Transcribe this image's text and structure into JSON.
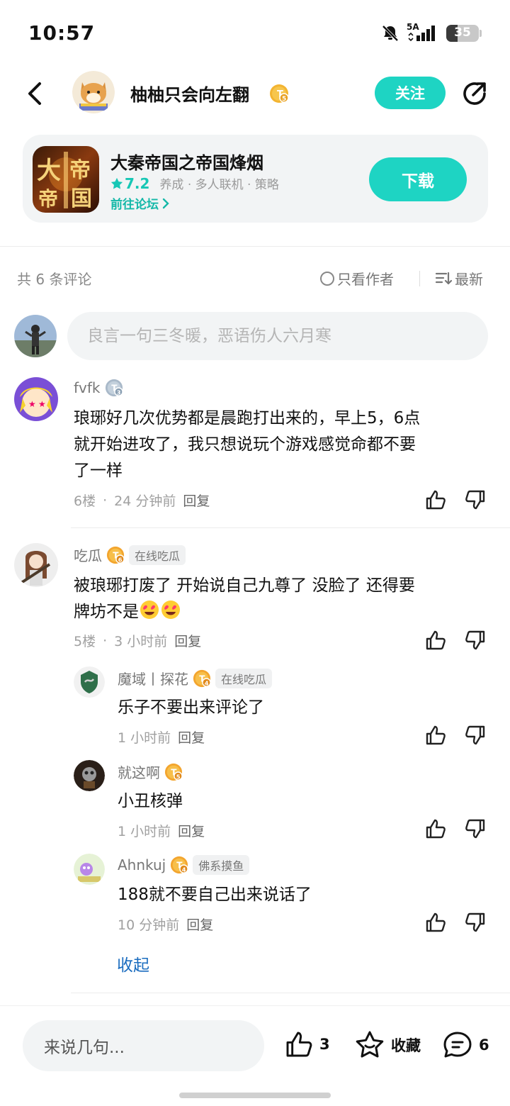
{
  "status": {
    "time": "10:57",
    "network": "5A",
    "battery": "35",
    "battery_level": 0.35
  },
  "header": {
    "username": "柚柚只会向左翻",
    "level": "5",
    "follow_label": "关注"
  },
  "game": {
    "title": "大秦帝国之帝国烽烟",
    "rating": "7.2",
    "tags": "养成 · 多人联机 · 策略",
    "forum_label": "前往论坛",
    "download_label": "下载",
    "icon_text_a": "大",
    "icon_text_b": "帝",
    "icon_text_c": "帝",
    "icon_text_d": "国"
  },
  "comments_bar": {
    "count_label": "共 6 条评论",
    "author_only_label": "只看作者",
    "sort_label": "最新"
  },
  "input": {
    "placeholder": "良言一句三冬暖，恶语伤人六月寒"
  },
  "comments": [
    {
      "name": "fvfk",
      "level": "3",
      "tag": "",
      "text_lines": [
        "琅琊好几次优势都是晨跑打出来的，早上5，6点",
        "就开始进攻了，我只想说玩个游戏感觉命都不要",
        "了一样"
      ],
      "floor": "6楼",
      "time": "24 分钟前",
      "reply_label": "回复"
    },
    {
      "name": "吃瓜",
      "level": "6",
      "tag": "在线吃瓜",
      "text_lines": [
        "被琅琊打废了  开始说自己九尊了   没脸了  还得要",
        "牌坊不是"
      ],
      "floor": "5楼",
      "time": "3 小时前",
      "reply_label": "回复"
    }
  ],
  "replies": [
    {
      "name": "魔域丨探花",
      "level": "4",
      "tag": "在线吃瓜",
      "text": "乐子不要出来评论了",
      "time": "1 小时前",
      "reply_label": "回复"
    },
    {
      "name": "就这啊",
      "level": "5",
      "tag": "",
      "text": "小丑核弹",
      "time": "1 小时前",
      "reply_label": "回复"
    },
    {
      "name": "Ahnkuj",
      "level": "4",
      "tag": "佛系摸鱼",
      "text": "188就不要自己出来说话了",
      "time": "10 分钟前",
      "reply_label": "回复"
    }
  ],
  "collapse_label": "收起",
  "bottom": {
    "input_label": "来说几句...",
    "like_count": "3",
    "favorite_label": "收藏",
    "comment_count": "6"
  }
}
